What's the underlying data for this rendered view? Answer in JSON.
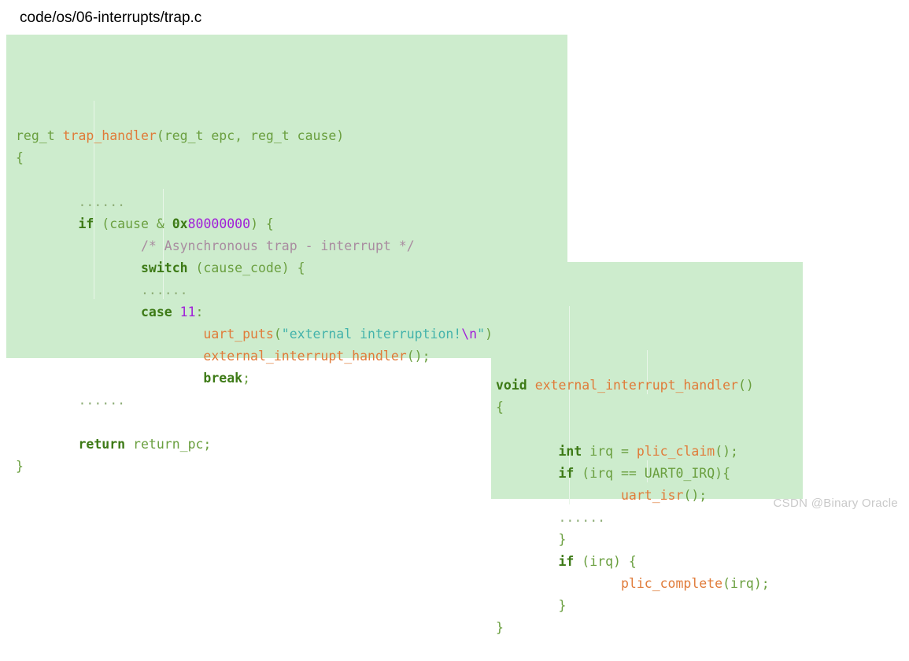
{
  "page": {
    "title": "code/os/06-interrupts/trap.c",
    "background_color": "#ffffff"
  },
  "watermark": {
    "text": "CSDN @Binary Oracle",
    "color": "#c9c9c9"
  },
  "theme": {
    "code_background": "#cdeccd",
    "plain": "#6a9f3f",
    "keyword": "#3d7a16",
    "function": "#e07b39",
    "string": "#44b3ab",
    "escape": "#a01fd8",
    "number": "#a01fd8",
    "comment": "#a98ca0",
    "ellipsis": "#8fae78",
    "indent_guide": "#e9f6e9"
  },
  "code_blocks": [
    {
      "id": "trap-handler",
      "file": "trap.c",
      "lines": [
        [
          {
            "t": "reg_t ",
            "c": "plain"
          },
          {
            "t": "trap_handler",
            "c": "fn"
          },
          {
            "t": "(reg_t epc, reg_t cause)",
            "c": "plain"
          }
        ],
        [
          {
            "t": "{",
            "c": "punct"
          }
        ],
        [
          {
            "t": "",
            "c": "plain"
          }
        ],
        [
          {
            "t": "        ......",
            "c": "dots"
          }
        ],
        [
          {
            "t": "        ",
            "c": "plain"
          },
          {
            "t": "if",
            "c": "kw"
          },
          {
            "t": " (cause & ",
            "c": "plain"
          },
          {
            "t": "0x",
            "c": "kw"
          },
          {
            "t": "80000000",
            "c": "num"
          },
          {
            "t": ") {",
            "c": "plain"
          }
        ],
        [
          {
            "t": "                ",
            "c": "plain"
          },
          {
            "t": "/* Asynchronous trap - interrupt */",
            "c": "comment"
          }
        ],
        [
          {
            "t": "                ",
            "c": "plain"
          },
          {
            "t": "switch",
            "c": "kw"
          },
          {
            "t": " (cause_code) {",
            "c": "plain"
          }
        ],
        [
          {
            "t": "                ......",
            "c": "dots"
          }
        ],
        [
          {
            "t": "                ",
            "c": "plain"
          },
          {
            "t": "case",
            "c": "kw"
          },
          {
            "t": " ",
            "c": "plain"
          },
          {
            "t": "11",
            "c": "num"
          },
          {
            "t": ":",
            "c": "plain"
          }
        ],
        [
          {
            "t": "                        ",
            "c": "plain"
          },
          {
            "t": "uart_puts",
            "c": "fn"
          },
          {
            "t": "(",
            "c": "plain"
          },
          {
            "t": "\"external interruption!",
            "c": "str"
          },
          {
            "t": "\\n",
            "c": "esc"
          },
          {
            "t": "\"",
            "c": "str"
          },
          {
            "t": ");",
            "c": "plain"
          }
        ],
        [
          {
            "t": "                        ",
            "c": "plain"
          },
          {
            "t": "external_interrupt_handler",
            "c": "fn"
          },
          {
            "t": "();",
            "c": "plain"
          }
        ],
        [
          {
            "t": "                        ",
            "c": "plain"
          },
          {
            "t": "break",
            "c": "kw"
          },
          {
            "t": ";",
            "c": "plain"
          }
        ],
        [
          {
            "t": "        ......",
            "c": "dots"
          }
        ],
        [
          {
            "t": "",
            "c": "plain"
          }
        ],
        [
          {
            "t": "        ",
            "c": "plain"
          },
          {
            "t": "return",
            "c": "kw"
          },
          {
            "t": " return_pc;",
            "c": "plain"
          }
        ],
        [
          {
            "t": "}",
            "c": "punct"
          }
        ]
      ]
    },
    {
      "id": "external-interrupt-handler",
      "file": "",
      "lines": [
        [
          {
            "t": "void",
            "c": "kw"
          },
          {
            "t": " ",
            "c": "plain"
          },
          {
            "t": "external_interrupt_handler",
            "c": "fn"
          },
          {
            "t": "()",
            "c": "plain"
          }
        ],
        [
          {
            "t": "{",
            "c": "punct"
          }
        ],
        [
          {
            "t": "",
            "c": "plain"
          }
        ],
        [
          {
            "t": "        ",
            "c": "plain"
          },
          {
            "t": "int",
            "c": "kw"
          },
          {
            "t": " irq = ",
            "c": "plain"
          },
          {
            "t": "plic_claim",
            "c": "fn"
          },
          {
            "t": "();",
            "c": "plain"
          }
        ],
        [
          {
            "t": "        ",
            "c": "plain"
          },
          {
            "t": "if",
            "c": "kw"
          },
          {
            "t": " (irq == UART0_IRQ){",
            "c": "plain"
          }
        ],
        [
          {
            "t": "                ",
            "c": "plain"
          },
          {
            "t": "uart_isr",
            "c": "fn"
          },
          {
            "t": "();",
            "c": "plain"
          }
        ],
        [
          {
            "t": "        ......",
            "c": "dots"
          }
        ],
        [
          {
            "t": "        }",
            "c": "punct"
          }
        ],
        [
          {
            "t": "        ",
            "c": "plain"
          },
          {
            "t": "if",
            "c": "kw"
          },
          {
            "t": " (irq) {",
            "c": "plain"
          }
        ],
        [
          {
            "t": "                ",
            "c": "plain"
          },
          {
            "t": "plic_complete",
            "c": "fn"
          },
          {
            "t": "(irq);",
            "c": "plain"
          }
        ],
        [
          {
            "t": "        }",
            "c": "punct"
          }
        ],
        [
          {
            "t": "}",
            "c": "punct"
          }
        ]
      ]
    }
  ]
}
